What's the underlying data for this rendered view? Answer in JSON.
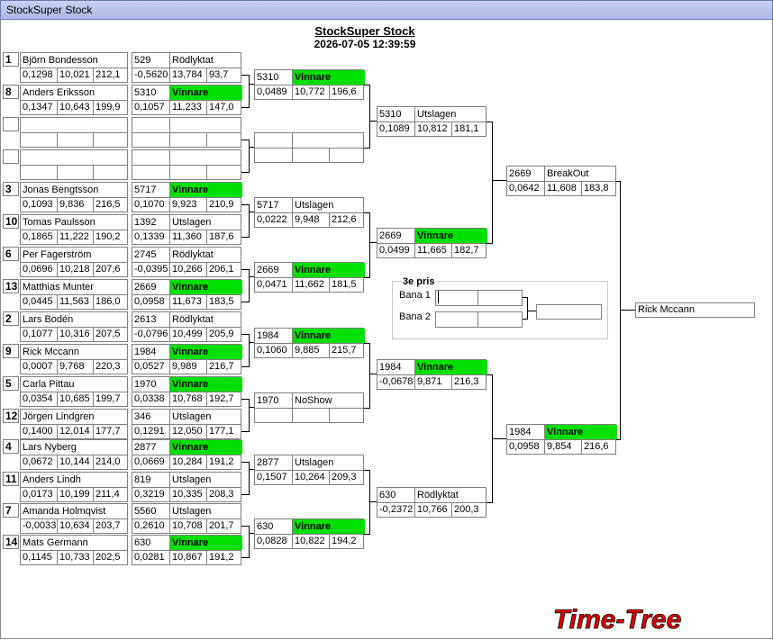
{
  "window": {
    "title": "StockSuper Stock"
  },
  "header": {
    "title": "StockSuper Stock",
    "datetime": "2026-07-05 12:39:59"
  },
  "colors": {
    "winner": "#00e000",
    "logo": "#e00000"
  },
  "round1": [
    {
      "seed": "1",
      "name": "Björn Bondesson",
      "rt": "0,1298",
      "et": "10,021",
      "speed": "212,1",
      "car": "529",
      "status": "Rödlyktat",
      "status_win": false,
      "d0": "-0,5620",
      "d1": "13,784",
      "d2": "93,7"
    },
    {
      "seed": "8",
      "name": "Anders Eriksson",
      "rt": "0,1347",
      "et": "10,643",
      "speed": "199,9",
      "car": "5310",
      "status": "Vinnare",
      "status_win": true,
      "d0": "0,1057",
      "d1": "11,233",
      "d2": "147,0"
    },
    {
      "seed": "",
      "name": "",
      "rt": "",
      "et": "",
      "speed": "",
      "car": "",
      "status": "",
      "status_win": false,
      "d0": "",
      "d1": "",
      "d2": ""
    },
    {
      "seed": "",
      "name": "",
      "rt": "",
      "et": "",
      "speed": "",
      "car": "",
      "status": "",
      "status_win": false,
      "d0": "",
      "d1": "",
      "d2": ""
    },
    {
      "seed": "3",
      "name": "Jonas Bengtsson",
      "rt": "0,1093",
      "et": "9,836",
      "speed": "216,5",
      "car": "5717",
      "status": "Vinnare",
      "status_win": true,
      "d0": "0,1070",
      "d1": "9,923",
      "d2": "210,9"
    },
    {
      "seed": "10",
      "name": "Tomas Paulsson",
      "rt": "0,1865",
      "et": "11,222",
      "speed": "190,2",
      "car": "1392",
      "status": "Utslagen",
      "status_win": false,
      "d0": "0,1339",
      "d1": "11,360",
      "d2": "187,6"
    },
    {
      "seed": "6",
      "name": "Per  Fagerström",
      "rt": "0,0696",
      "et": "10,218",
      "speed": "207,6",
      "car": "2745",
      "status": "Rödlyktat",
      "status_win": false,
      "d0": "-0,0395",
      "d1": "10,266",
      "d2": "206,1"
    },
    {
      "seed": "13",
      "name": "Matthias Munter",
      "rt": "0,0445",
      "et": "11,563",
      "speed": "186,0",
      "car": "2669",
      "status": "Vinnare",
      "status_win": true,
      "d0": "0,0958",
      "d1": "11,673",
      "d2": "183,5"
    },
    {
      "seed": "2",
      "name": "Lars Bodén",
      "rt": "0,1077",
      "et": "10,316",
      "speed": "207,5",
      "car": "2613",
      "status": "Rödlyktat",
      "status_win": false,
      "d0": "-0,0796",
      "d1": "10,499",
      "d2": "205,9"
    },
    {
      "seed": "9",
      "name": "Rick Mccann",
      "rt": "0,0007",
      "et": "9,768",
      "speed": "220,3",
      "car": "1984",
      "status": "Vinnare",
      "status_win": true,
      "d0": "0,0527",
      "d1": "9,989",
      "d2": "216,7"
    },
    {
      "seed": "5",
      "name": "Carla Pittau",
      "rt": "0,0354",
      "et": "10,685",
      "speed": "199,7",
      "car": "1970",
      "status": "Vinnare",
      "status_win": true,
      "d0": "0,0338",
      "d1": "10,768",
      "d2": "192,7"
    },
    {
      "seed": "12",
      "name": "Jörgen Lindgren",
      "rt": "0,1400",
      "et": "12,014",
      "speed": "177,7",
      "car": "346",
      "status": "Utslagen",
      "status_win": false,
      "d0": "0,1291",
      "d1": "12,050",
      "d2": "177,1"
    },
    {
      "seed": "4",
      "name": "Lars Nyberg",
      "rt": "0,0672",
      "et": "10,144",
      "speed": "214,0",
      "car": "2877",
      "status": "Vinnare",
      "status_win": true,
      "d0": "0,0669",
      "d1": "10,284",
      "d2": "191,2"
    },
    {
      "seed": "11",
      "name": "Anders Lindh",
      "rt": "0,0173",
      "et": "10,199",
      "speed": "211,4",
      "car": "819",
      "status": "Utslagen",
      "status_win": false,
      "d0": "0,3219",
      "d1": "10,335",
      "d2": "208,3"
    },
    {
      "seed": "7",
      "name": "Amanda Holmqvist",
      "rt": "-0,0033",
      "et": "10,634",
      "speed": "203,7",
      "car": "5560",
      "status": "Utslagen",
      "status_win": false,
      "d0": "0,2610",
      "d1": "10,708",
      "d2": "201,7"
    },
    {
      "seed": "14",
      "name": "Mats Germann",
      "rt": "0,1145",
      "et": "10,733",
      "speed": "202,5",
      "car": "630",
      "status": "Vinnare",
      "status_win": true,
      "d0": "0,0281",
      "d1": "10,867",
      "d2": "191,2"
    }
  ],
  "round2": [
    {
      "car": "5310",
      "status": "Vinnare",
      "status_win": true,
      "d0": "0,0489",
      "d1": "10,772",
      "d2": "196,6"
    },
    {
      "car": "",
      "status": "",
      "status_win": false,
      "d0": "",
      "d1": "",
      "d2": ""
    },
    {
      "car": "5717",
      "status": "Utslagen",
      "status_win": false,
      "d0": "0,0222",
      "d1": "9,948",
      "d2": "212,6"
    },
    {
      "car": "2669",
      "status": "Vinnare",
      "status_win": true,
      "d0": "0,0471",
      "d1": "11,662",
      "d2": "181,5"
    },
    {
      "car": "1984",
      "status": "Vinnare",
      "status_win": true,
      "d0": "0,1060",
      "d1": "9,885",
      "d2": "215,7"
    },
    {
      "car": "1970",
      "status": "NoShow",
      "status_win": false,
      "d0": "",
      "d1": "",
      "d2": ""
    },
    {
      "car": "2877",
      "status": "Utslagen",
      "status_win": false,
      "d0": "0,1507",
      "d1": "10,264",
      "d2": "209,3"
    },
    {
      "car": "630",
      "status": "Vinnare",
      "status_win": true,
      "d0": "0,0828",
      "d1": "10,822",
      "d2": "194,2"
    }
  ],
  "round3": [
    {
      "car": "5310",
      "status": "Utslagen",
      "status_win": false,
      "d0": "0,1089",
      "d1": "10,812",
      "d2": "181,1"
    },
    {
      "car": "2669",
      "status": "Vinnare",
      "status_win": true,
      "d0": "0,0499",
      "d1": "11,665",
      "d2": "182,7"
    },
    {
      "car": "1984",
      "status": "Vinnare",
      "status_win": true,
      "d0": "-0,0678",
      "d1": "9,871",
      "d2": "216,3"
    },
    {
      "car": "630",
      "status": "Rödlyktat",
      "status_win": false,
      "d0": "-0,2372",
      "d1": "10,766",
      "d2": "200,3"
    }
  ],
  "round4": [
    {
      "car": "2669",
      "status": "BreakOut",
      "status_win": false,
      "d0": "0,0642",
      "d1": "11,608",
      "d2": "183,8"
    },
    {
      "car": "1984",
      "status": "Vinnare",
      "status_win": true,
      "d0": "0,0958",
      "d1": "9,854",
      "d2": "216,6"
    }
  ],
  "third_place": {
    "title": "3e pris",
    "lane1": "Bana 1",
    "lane2": "Bana 2"
  },
  "final": {
    "winner": "Rick Mccann"
  },
  "logo": {
    "text": "Time-Tree"
  }
}
